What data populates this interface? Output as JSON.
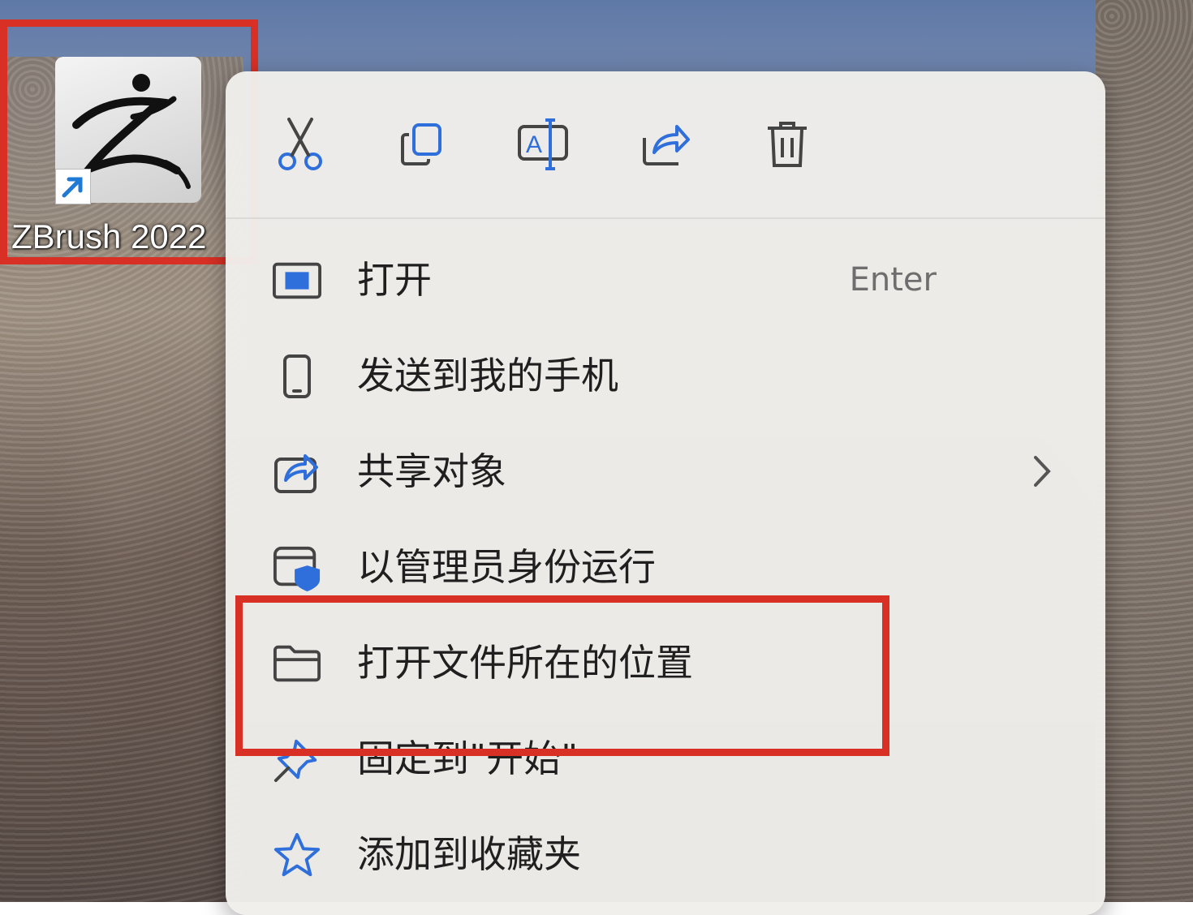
{
  "desktop_icon": {
    "label": "ZBrush 2022",
    "highlight_color": "#d93025"
  },
  "context_menu": {
    "toolbar": [
      {
        "name": "cut-icon"
      },
      {
        "name": "copy-icon"
      },
      {
        "name": "rename-icon"
      },
      {
        "name": "share-icon"
      },
      {
        "name": "delete-icon"
      }
    ],
    "items": [
      {
        "label": "打开",
        "shortcut": "Enter",
        "icon": "open-app-icon"
      },
      {
        "label": "发送到我的手机",
        "icon": "phone-icon"
      },
      {
        "label": "共享对象",
        "icon": "share-icon",
        "has_submenu": true
      },
      {
        "label": "以管理员身份运行",
        "icon": "admin-shield-icon"
      },
      {
        "label": "打开文件所在的位置",
        "icon": "folder-icon",
        "highlighted": true
      },
      {
        "label": "固定到\"开始\"",
        "icon": "pin-icon"
      },
      {
        "label": "添加到收藏夹",
        "icon": "star-icon"
      }
    ],
    "accent_color": "#2f6fdc"
  }
}
